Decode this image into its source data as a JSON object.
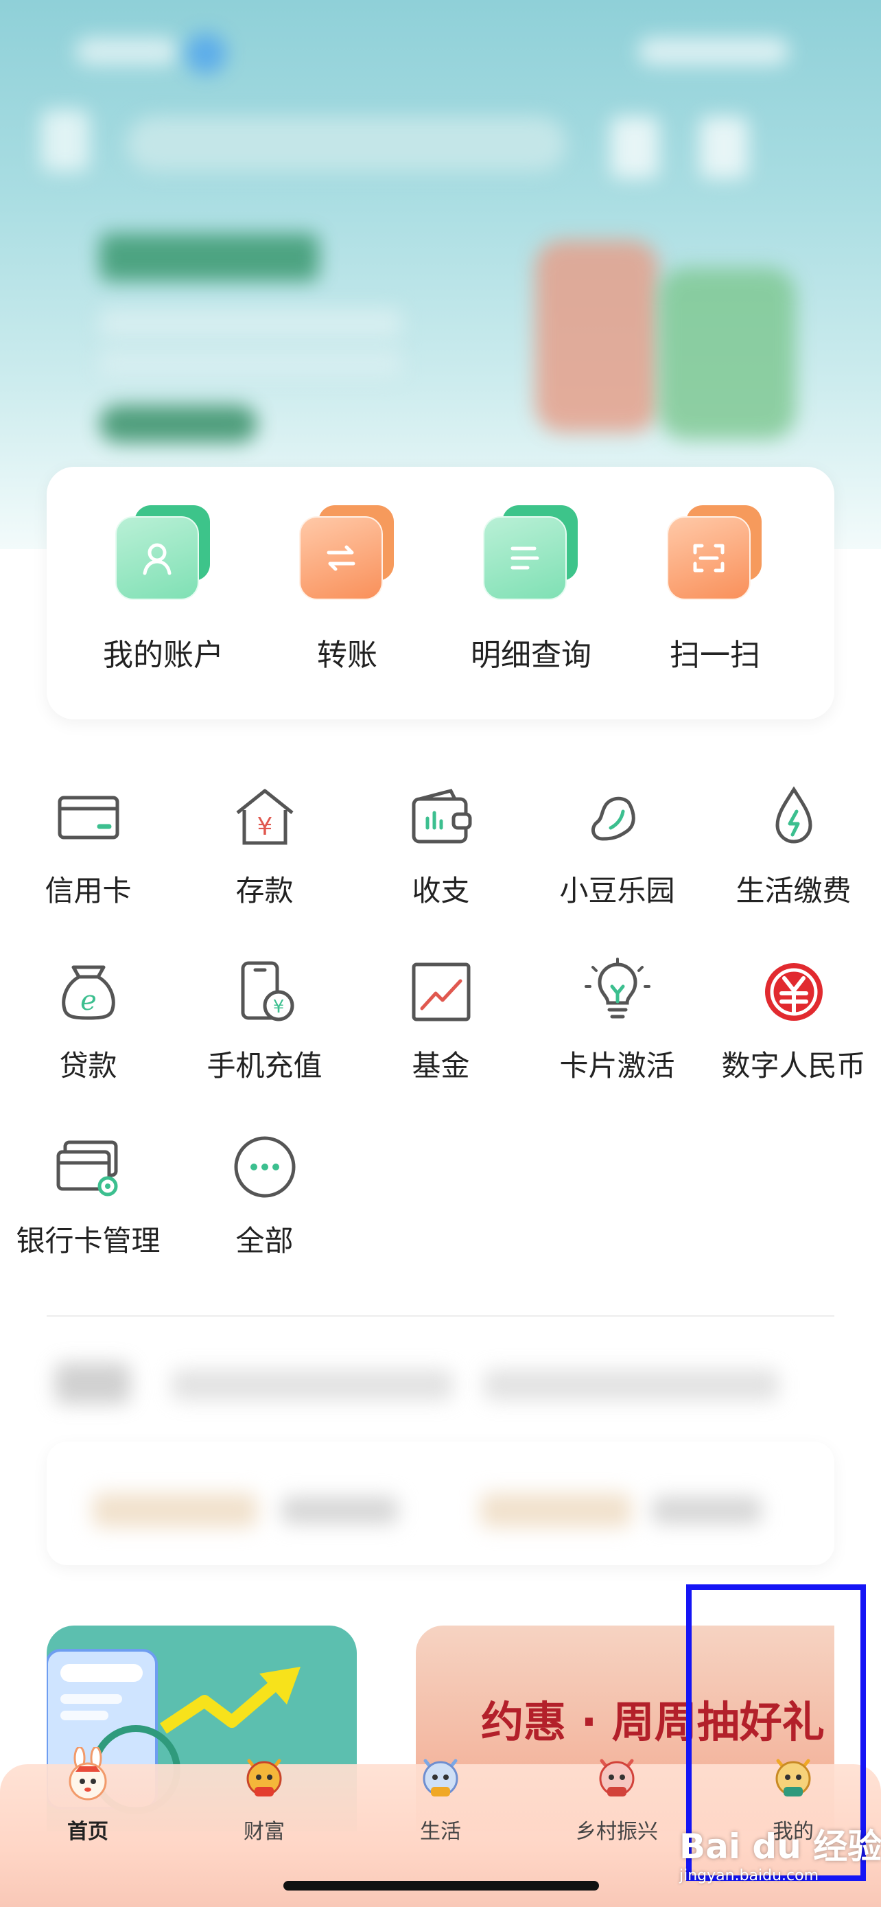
{
  "quick_actions": [
    {
      "label": "我的账户",
      "icon": "account-icon",
      "theme": "green"
    },
    {
      "label": "转账",
      "icon": "transfer-icon",
      "theme": "orange"
    },
    {
      "label": "明细查询",
      "icon": "details-icon",
      "theme": "green"
    },
    {
      "label": "扫一扫",
      "icon": "scan-icon",
      "theme": "orange"
    }
  ],
  "services": [
    {
      "label": "信用卡",
      "icon": "credit-card-icon"
    },
    {
      "label": "存款",
      "icon": "deposit-icon"
    },
    {
      "label": "收支",
      "icon": "wallet-icon"
    },
    {
      "label": "小豆乐园",
      "icon": "bean-icon"
    },
    {
      "label": "生活缴费",
      "icon": "utility-drop-icon"
    },
    {
      "label": "贷款",
      "icon": "loan-bag-icon"
    },
    {
      "label": "手机充值",
      "icon": "phone-recharge-icon"
    },
    {
      "label": "基金",
      "icon": "fund-chart-icon"
    },
    {
      "label": "卡片激活",
      "icon": "bulb-icon"
    },
    {
      "label": "数字人民币",
      "icon": "digital-rmb-icon"
    },
    {
      "label": "银行卡管理",
      "icon": "card-manage-icon"
    },
    {
      "label": "全部",
      "icon": "more-icon"
    }
  ],
  "promo": {
    "right_title": "约惠 · 周周抽好礼"
  },
  "tabs": [
    {
      "label": "首页",
      "icon": "rabbit-mascot-icon",
      "active": true
    },
    {
      "label": "财富",
      "icon": "dragon-mascot-icon",
      "active": false
    },
    {
      "label": "生活",
      "icon": "dragon-mascot-icon",
      "active": false
    },
    {
      "label": "乡村振兴",
      "icon": "dragon-mascot-icon",
      "active": false
    },
    {
      "label": "我的",
      "icon": "dragon-mascot-icon",
      "active": false
    }
  ],
  "watermark": {
    "brand": "Bai du 经验",
    "url": "jingyan.baidu.com"
  },
  "colors": {
    "accent_green": "#3dc48a",
    "accent_orange": "#f69a5c",
    "highlight": "#1515f5",
    "promo_red": "#b3202a"
  }
}
